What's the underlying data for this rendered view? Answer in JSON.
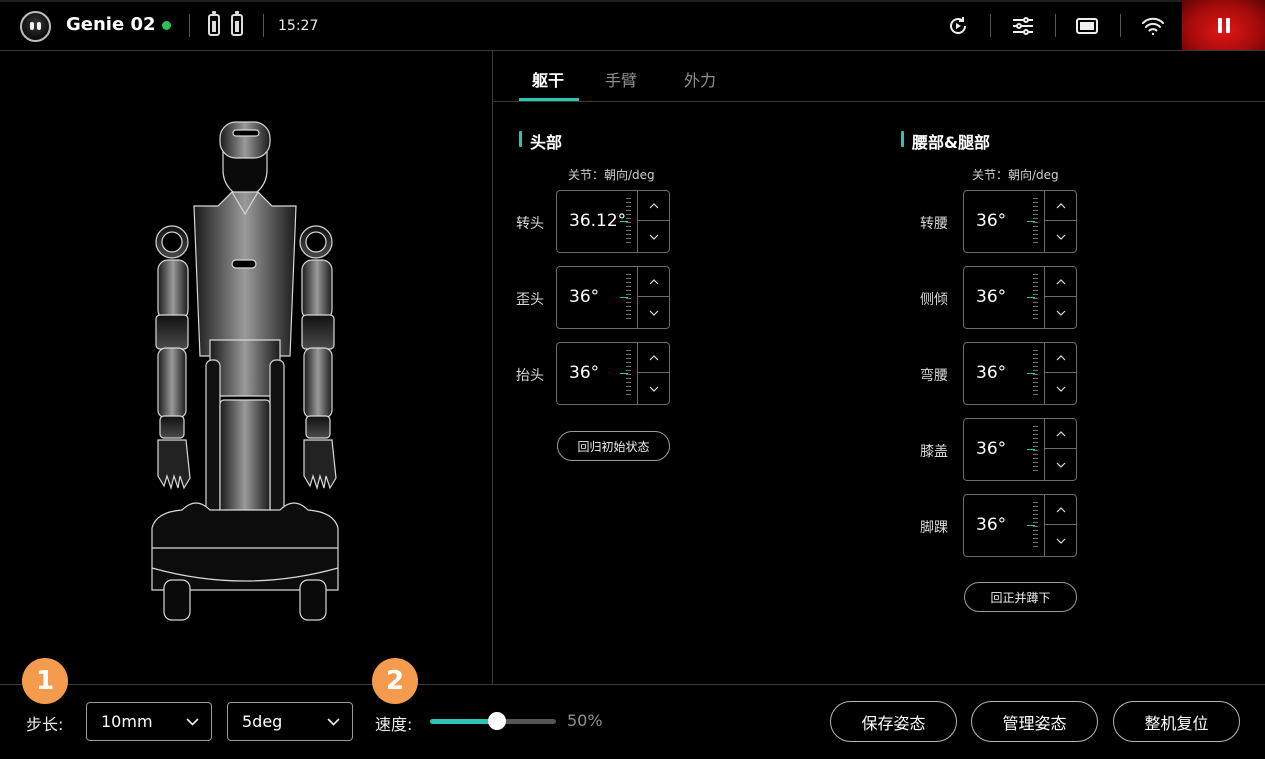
{
  "header": {
    "robot_name": "Genie 02",
    "time": "15:27",
    "icons": [
      "robot-face-icon",
      "battery-icon",
      "battery-icon",
      "replay-icon",
      "sliders-icon",
      "screen-icon",
      "wifi-icon",
      "pause-icon"
    ],
    "status_color": "#2ec05c",
    "pause_color": "#e21717"
  },
  "tabs": [
    "躯干",
    "手臂",
    "外力"
  ],
  "active_tab": "躯干",
  "accent_color": "#2bc4b6",
  "head": {
    "title": "头部",
    "column_header": "关节：朝向/deg",
    "joints": [
      {
        "label": "转头",
        "value": "36.12°"
      },
      {
        "label": "歪头",
        "value": "36°"
      },
      {
        "label": "抬头",
        "value": "36°"
      }
    ],
    "reset_label": "回归初始状态"
  },
  "waist_legs": {
    "title": "腰部&腿部",
    "column_header": "关节：朝向/deg",
    "joints": [
      {
        "label": "转腰",
        "value": "36°"
      },
      {
        "label": "侧倾",
        "value": "36°"
      },
      {
        "label": "弯腰",
        "value": "36°"
      },
      {
        "label": "膝盖",
        "value": "36°"
      },
      {
        "label": "脚踝",
        "value": "36°"
      }
    ],
    "reset_label": "回正并蹲下"
  },
  "bottom": {
    "badge1": "1",
    "badge2": "2",
    "step_label": "步长:",
    "step_mm": "10mm",
    "step_deg": "5deg",
    "speed_label": "速度:",
    "speed_value": "50%",
    "speed_fraction": 0.5,
    "save_label": "保存姿态",
    "manage_label": "管理姿态",
    "reset_label": "整机复位",
    "badge_color": "#f59b4d"
  }
}
